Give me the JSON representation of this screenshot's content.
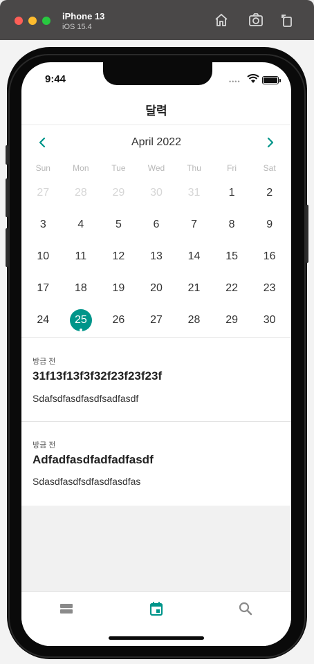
{
  "simulator": {
    "device_name": "iPhone 13",
    "os_version": "iOS 15.4"
  },
  "status_bar": {
    "time": "9:44"
  },
  "header": {
    "title": "달력"
  },
  "calendar": {
    "month_label": "April 2022",
    "weekdays": [
      "Sun",
      "Mon",
      "Tue",
      "Wed",
      "Thu",
      "Fri",
      "Sat"
    ],
    "weeks": [
      [
        "27",
        "28",
        "29",
        "30",
        "31",
        "1",
        "2"
      ],
      [
        "3",
        "4",
        "5",
        "6",
        "7",
        "8",
        "9"
      ],
      [
        "10",
        "11",
        "12",
        "13",
        "14",
        "15",
        "16"
      ],
      [
        "17",
        "18",
        "19",
        "20",
        "21",
        "22",
        "23"
      ],
      [
        "24",
        "25",
        "26",
        "27",
        "28",
        "29",
        "30"
      ]
    ],
    "selected_day": "25",
    "accent_color": "#00958a"
  },
  "posts": [
    {
      "time": "방금 전",
      "title": "31f13f13f3f32f23f23f23f",
      "body": "Sdafsdfasdfasdfsadfasdf"
    },
    {
      "time": "방금 전",
      "title": "Adfadfasdfadfadfasdf",
      "body": "Sdasdfasdfsdfasdfasdfas"
    }
  ],
  "tabbar": {
    "items": [
      {
        "icon": "list-icon",
        "active": false
      },
      {
        "icon": "calendar-icon",
        "active": true
      },
      {
        "icon": "search-icon",
        "active": false
      }
    ],
    "active_color": "#00958a",
    "inactive_color": "#8a8a8a"
  }
}
